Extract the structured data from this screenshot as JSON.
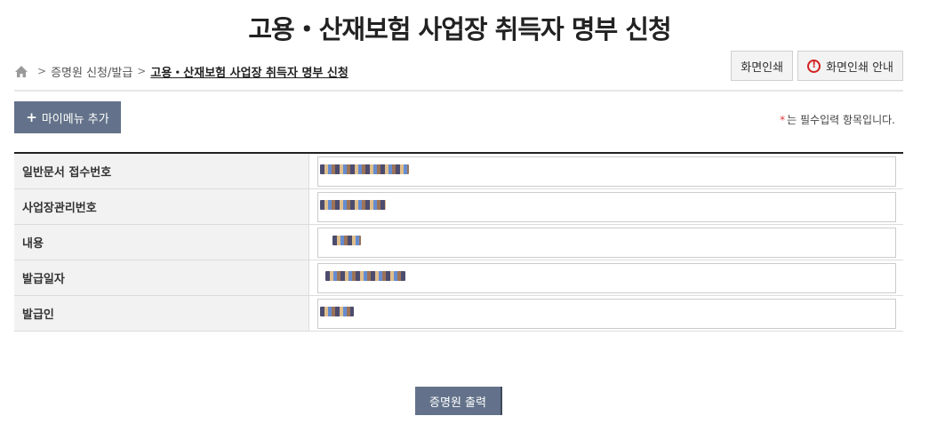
{
  "page": {
    "title": "고용・산재보험 사업장 취득자 명부 신청"
  },
  "breadcrumb": {
    "items": [
      "증명원 신청/발급",
      "고용・산재보험 사업장 취득자 명부 신청"
    ]
  },
  "top_buttons": {
    "print": "화면인쇄",
    "print_guide": "화면인쇄 안내"
  },
  "mymenu": {
    "label": "마이메뉴 추가",
    "icon": "plus-icon"
  },
  "required_note": {
    "star": "*",
    "text": "는 필수입력 항목입니다."
  },
  "form": {
    "rows": [
      {
        "label": "일반문서 접수번호",
        "value": ""
      },
      {
        "label": "사업장관리번호",
        "value": ""
      },
      {
        "label": "내용",
        "value": ""
      },
      {
        "label": "발급일자",
        "value": ""
      },
      {
        "label": "발급인",
        "value": ""
      }
    ]
  },
  "actions": {
    "print_certificate": "증명원 출력"
  },
  "colors": {
    "primary_button": "#63728a",
    "required_star": "#e03b3b",
    "warn": "#d42020"
  }
}
